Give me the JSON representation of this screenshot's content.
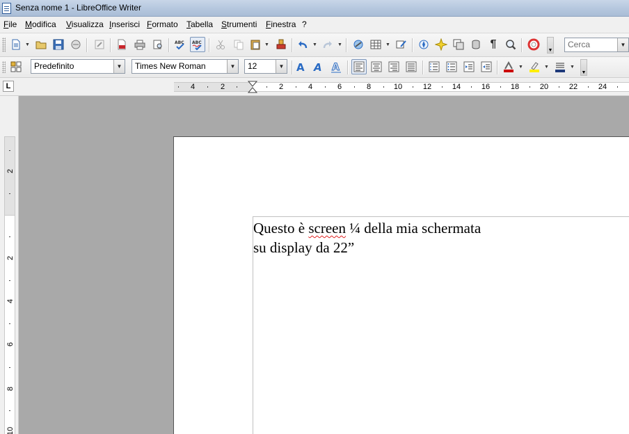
{
  "window": {
    "title": "Senza nome 1 - LibreOffice Writer"
  },
  "menu": {
    "items": [
      "File",
      "Modifica",
      "Visualizza",
      "Inserisci",
      "Formato",
      "Tabella",
      "Strumenti",
      "Finestra",
      "?"
    ]
  },
  "toolbar_standard": {
    "search_placeholder": "Cerca",
    "icons": [
      "new-document-icon",
      "open-icon",
      "save-icon",
      "email-icon",
      "edit-mode-icon",
      "export-pdf-icon",
      "print-icon",
      "print-preview-icon",
      "spellcheck-icon",
      "autospellcheck-icon",
      "cut-icon",
      "copy-icon",
      "paste-icon",
      "clone-formatting-icon",
      "undo-icon",
      "redo-icon",
      "hyperlink-icon",
      "table-icon",
      "draw-functions-icon",
      "navigator-icon",
      "gallery-icon",
      "data-sources-icon",
      "nonprinting-characters-icon",
      "zoom-icon",
      "help-icon"
    ]
  },
  "toolbar_formatting": {
    "paragraph_style": "Predefinito",
    "font_name": "Times New Roman",
    "font_size": "12",
    "icons": [
      "styles-formatting-icon",
      "bold-icon",
      "italic-icon",
      "underline-icon",
      "align-left-icon",
      "align-center-icon",
      "align-right-icon",
      "justify-icon",
      "numbering-icon",
      "bullets-icon",
      "decrease-indent-icon",
      "increase-indent-icon",
      "font-color-icon",
      "highlighting-icon",
      "background-color-icon"
    ]
  },
  "ruler": {
    "h_labels": [
      "4",
      "2",
      "2",
      "4",
      "6",
      "8",
      "10",
      "12",
      "14",
      "16",
      "18",
      "20",
      "22",
      "24"
    ],
    "v_labels": [
      "2",
      "2",
      "4",
      "6",
      "8",
      "10"
    ]
  },
  "document": {
    "line1_a": "Questo è ",
    "line1_b": "screen",
    "line1_c": " ¼ della mia schermata",
    "line2": "su display da 22”"
  },
  "colors": {
    "titlebar": "#b5c7de",
    "workspace": "#a9a9a9",
    "spell_underline": "#e02020"
  }
}
